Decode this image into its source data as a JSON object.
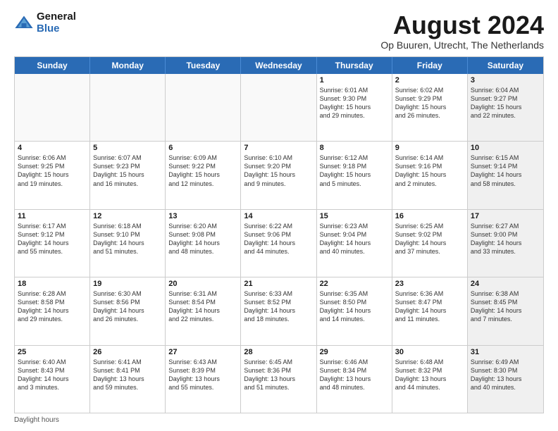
{
  "logo": {
    "general": "General",
    "blue": "Blue"
  },
  "title": "August 2024",
  "subtitle": "Op Buuren, Utrecht, The Netherlands",
  "days": [
    "Sunday",
    "Monday",
    "Tuesday",
    "Wednesday",
    "Thursday",
    "Friday",
    "Saturday"
  ],
  "footer": "Daylight hours",
  "weeks": [
    [
      {
        "day": "",
        "content": "",
        "empty": true
      },
      {
        "day": "",
        "content": "",
        "empty": true
      },
      {
        "day": "",
        "content": "",
        "empty": true
      },
      {
        "day": "",
        "content": "",
        "empty": true
      },
      {
        "day": "1",
        "content": "Sunrise: 6:01 AM\nSunset: 9:30 PM\nDaylight: 15 hours\nand 29 minutes.",
        "empty": false
      },
      {
        "day": "2",
        "content": "Sunrise: 6:02 AM\nSunset: 9:29 PM\nDaylight: 15 hours\nand 26 minutes.",
        "empty": false
      },
      {
        "day": "3",
        "content": "Sunrise: 6:04 AM\nSunset: 9:27 PM\nDaylight: 15 hours\nand 22 minutes.",
        "empty": false,
        "shaded": true
      }
    ],
    [
      {
        "day": "4",
        "content": "Sunrise: 6:06 AM\nSunset: 9:25 PM\nDaylight: 15 hours\nand 19 minutes.",
        "empty": false
      },
      {
        "day": "5",
        "content": "Sunrise: 6:07 AM\nSunset: 9:23 PM\nDaylight: 15 hours\nand 16 minutes.",
        "empty": false
      },
      {
        "day": "6",
        "content": "Sunrise: 6:09 AM\nSunset: 9:22 PM\nDaylight: 15 hours\nand 12 minutes.",
        "empty": false
      },
      {
        "day": "7",
        "content": "Sunrise: 6:10 AM\nSunset: 9:20 PM\nDaylight: 15 hours\nand 9 minutes.",
        "empty": false
      },
      {
        "day": "8",
        "content": "Sunrise: 6:12 AM\nSunset: 9:18 PM\nDaylight: 15 hours\nand 5 minutes.",
        "empty": false
      },
      {
        "day": "9",
        "content": "Sunrise: 6:14 AM\nSunset: 9:16 PM\nDaylight: 15 hours\nand 2 minutes.",
        "empty": false
      },
      {
        "day": "10",
        "content": "Sunrise: 6:15 AM\nSunset: 9:14 PM\nDaylight: 14 hours\nand 58 minutes.",
        "empty": false,
        "shaded": true
      }
    ],
    [
      {
        "day": "11",
        "content": "Sunrise: 6:17 AM\nSunset: 9:12 PM\nDaylight: 14 hours\nand 55 minutes.",
        "empty": false
      },
      {
        "day": "12",
        "content": "Sunrise: 6:18 AM\nSunset: 9:10 PM\nDaylight: 14 hours\nand 51 minutes.",
        "empty": false
      },
      {
        "day": "13",
        "content": "Sunrise: 6:20 AM\nSunset: 9:08 PM\nDaylight: 14 hours\nand 48 minutes.",
        "empty": false
      },
      {
        "day": "14",
        "content": "Sunrise: 6:22 AM\nSunset: 9:06 PM\nDaylight: 14 hours\nand 44 minutes.",
        "empty": false
      },
      {
        "day": "15",
        "content": "Sunrise: 6:23 AM\nSunset: 9:04 PM\nDaylight: 14 hours\nand 40 minutes.",
        "empty": false
      },
      {
        "day": "16",
        "content": "Sunrise: 6:25 AM\nSunset: 9:02 PM\nDaylight: 14 hours\nand 37 minutes.",
        "empty": false
      },
      {
        "day": "17",
        "content": "Sunrise: 6:27 AM\nSunset: 9:00 PM\nDaylight: 14 hours\nand 33 minutes.",
        "empty": false,
        "shaded": true
      }
    ],
    [
      {
        "day": "18",
        "content": "Sunrise: 6:28 AM\nSunset: 8:58 PM\nDaylight: 14 hours\nand 29 minutes.",
        "empty": false
      },
      {
        "day": "19",
        "content": "Sunrise: 6:30 AM\nSunset: 8:56 PM\nDaylight: 14 hours\nand 26 minutes.",
        "empty": false
      },
      {
        "day": "20",
        "content": "Sunrise: 6:31 AM\nSunset: 8:54 PM\nDaylight: 14 hours\nand 22 minutes.",
        "empty": false
      },
      {
        "day": "21",
        "content": "Sunrise: 6:33 AM\nSunset: 8:52 PM\nDaylight: 14 hours\nand 18 minutes.",
        "empty": false
      },
      {
        "day": "22",
        "content": "Sunrise: 6:35 AM\nSunset: 8:50 PM\nDaylight: 14 hours\nand 14 minutes.",
        "empty": false
      },
      {
        "day": "23",
        "content": "Sunrise: 6:36 AM\nSunset: 8:47 PM\nDaylight: 14 hours\nand 11 minutes.",
        "empty": false
      },
      {
        "day": "24",
        "content": "Sunrise: 6:38 AM\nSunset: 8:45 PM\nDaylight: 14 hours\nand 7 minutes.",
        "empty": false,
        "shaded": true
      }
    ],
    [
      {
        "day": "25",
        "content": "Sunrise: 6:40 AM\nSunset: 8:43 PM\nDaylight: 14 hours\nand 3 minutes.",
        "empty": false
      },
      {
        "day": "26",
        "content": "Sunrise: 6:41 AM\nSunset: 8:41 PM\nDaylight: 13 hours\nand 59 minutes.",
        "empty": false
      },
      {
        "day": "27",
        "content": "Sunrise: 6:43 AM\nSunset: 8:39 PM\nDaylight: 13 hours\nand 55 minutes.",
        "empty": false
      },
      {
        "day": "28",
        "content": "Sunrise: 6:45 AM\nSunset: 8:36 PM\nDaylight: 13 hours\nand 51 minutes.",
        "empty": false
      },
      {
        "day": "29",
        "content": "Sunrise: 6:46 AM\nSunset: 8:34 PM\nDaylight: 13 hours\nand 48 minutes.",
        "empty": false
      },
      {
        "day": "30",
        "content": "Sunrise: 6:48 AM\nSunset: 8:32 PM\nDaylight: 13 hours\nand 44 minutes.",
        "empty": false
      },
      {
        "day": "31",
        "content": "Sunrise: 6:49 AM\nSunset: 8:30 PM\nDaylight: 13 hours\nand 40 minutes.",
        "empty": false,
        "shaded": true
      }
    ]
  ]
}
